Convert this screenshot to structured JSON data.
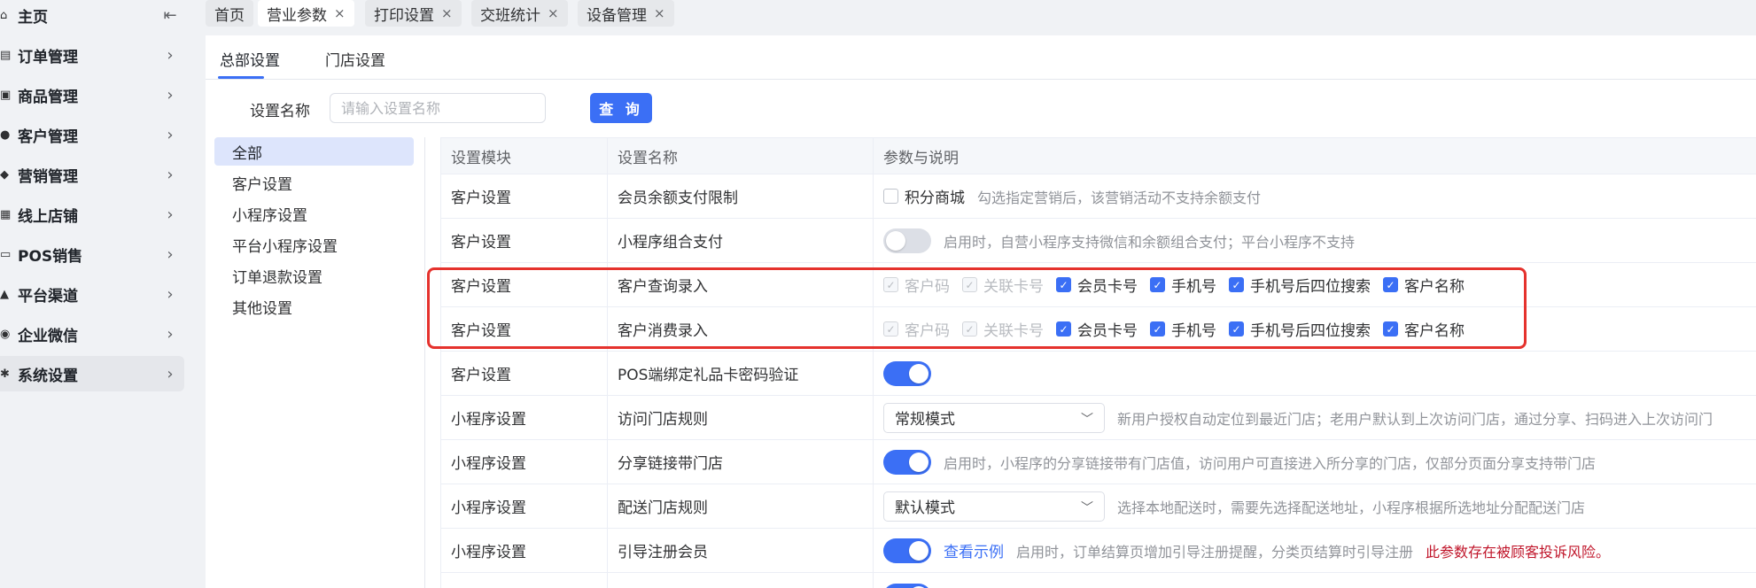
{
  "sidebar": {
    "items": [
      {
        "label": "主页",
        "icon": "home-icon",
        "chev": "⇤"
      },
      {
        "label": "订单管理",
        "icon": "order-icon",
        "chev": "›"
      },
      {
        "label": "商品管理",
        "icon": "goods-icon",
        "chev": "›"
      },
      {
        "label": "客户管理",
        "icon": "user-icon",
        "chev": "›"
      },
      {
        "label": "营销管理",
        "icon": "marketing-icon",
        "chev": "›"
      },
      {
        "label": "线上店铺",
        "icon": "shop-icon",
        "chev": "›"
      },
      {
        "label": "POS销售",
        "icon": "pos-icon",
        "chev": "›"
      },
      {
        "label": "平台渠道",
        "icon": "channel-icon",
        "chev": "›"
      },
      {
        "label": "企业微信",
        "icon": "wechat-icon",
        "chev": "›"
      },
      {
        "label": "系统设置",
        "icon": "settings-icon",
        "chev": "›"
      }
    ]
  },
  "tabs": [
    {
      "label": "首页"
    },
    {
      "label": "营业参数",
      "close": "×"
    },
    {
      "label": "打印设置",
      "close": "×"
    },
    {
      "label": "交班统计",
      "close": "×"
    },
    {
      "label": "设备管理",
      "close": "×"
    }
  ],
  "subtabs": [
    "总部设置",
    "门店设置"
  ],
  "filter": {
    "label": "设置名称",
    "placeholder": "请输入设置名称",
    "button": "查 询"
  },
  "categories": [
    "全部",
    "客户设置",
    "小程序设置",
    "平台小程序设置",
    "订单退款设置",
    "其他设置"
  ],
  "table": {
    "headers": [
      "设置模块",
      "设置名称",
      "参数与说明"
    ],
    "rows": [
      {
        "module": "客户设置",
        "name": "会员余额支付限制",
        "checkbox": "积分商城",
        "desc": "勾选指定营销后，该营销活动不支持余额支付"
      },
      {
        "module": "客户设置",
        "name": "小程序组合支付",
        "switch": "off",
        "desc": "启用时，自营小程序支持微信和余额组合支付；平台小程序不支持"
      },
      {
        "module": "客户设置",
        "name": "客户查询录入",
        "options": [
          "客户码",
          "关联卡号",
          "会员卡号",
          "手机号",
          "手机号后四位搜索",
          "客户名称"
        ]
      },
      {
        "module": "客户设置",
        "name": "客户消费录入",
        "options": [
          "客户码",
          "关联卡号",
          "会员卡号",
          "手机号",
          "手机号后四位搜索",
          "客户名称"
        ]
      },
      {
        "module": "客户设置",
        "name": "POS端绑定礼品卡密码验证",
        "switch": "on"
      },
      {
        "module": "小程序设置",
        "name": "访问门店规则",
        "select": "常规模式",
        "desc": "新用户授权自动定位到最近门店；老用户默认到上次访问门店，通过分享、扫码进入上次访问门"
      },
      {
        "module": "小程序设置",
        "name": "分享链接带门店",
        "switch": "on",
        "desc": "启用时，小程序的分享链接带有门店值，访问用户可直接进入所分享的门店，仅部分页面分享支持带门店"
      },
      {
        "module": "小程序设置",
        "name": "配送门店规则",
        "select": "默认模式",
        "desc": "选择本地配送时，需要先选择配送地址，小程序根据所选地址分配配送门店"
      },
      {
        "module": "小程序设置",
        "name": "引导注册会员",
        "switch": "on",
        "link": "查看示例",
        "desc": "启用时，订单结算页增加引导注册提醒，分类页结算时引导注册",
        "warn": "此参数存在被顾客投诉风险。"
      }
    ]
  },
  "colors": {
    "accent": "#3b6ff5",
    "highlight": "#e5322d",
    "warn": "#c0152a"
  }
}
